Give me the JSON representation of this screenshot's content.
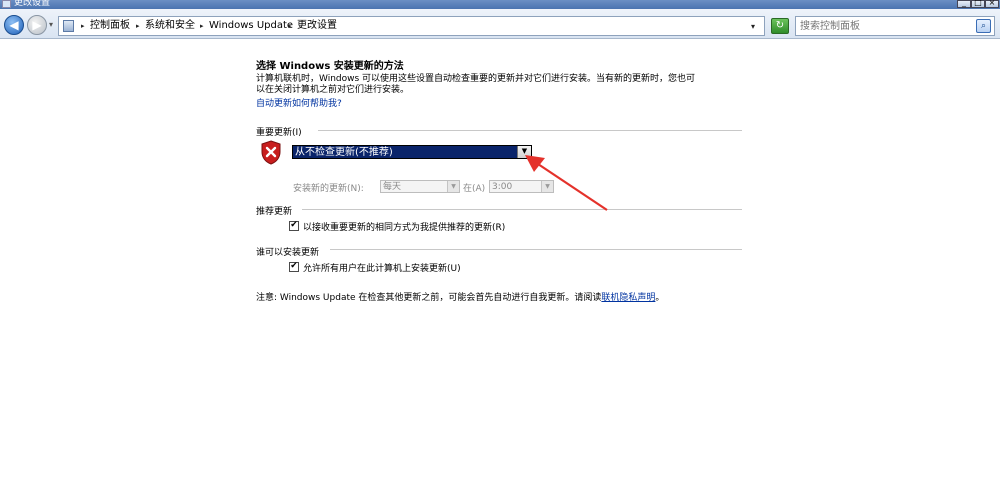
{
  "window": {
    "title": "更改设置"
  },
  "titlebar_buttons": {
    "minimize": "_",
    "maximize": "□",
    "close": "×"
  },
  "nav": {
    "back_glyph": "◀",
    "forward_glyph": "▶",
    "dropdown_glyph": "▾",
    "refresh_glyph": "↻",
    "search_glyph": "⌕"
  },
  "breadcrumb": [
    "控制面板",
    "系统和安全",
    "Windows Update",
    "更改设置"
  ],
  "search": {
    "placeholder": "搜索控制面板"
  },
  "main": {
    "title": "选择 Windows 安装更新的方法",
    "description_line1": "计算机联机时，Windows 可以使用这些设置自动检查重要的更新并对它们进行安装。当有新的更新时，您也可",
    "description_line2": "以在关闭计算机之前对它们进行安装。",
    "help_link": "自动更新如何帮助我?"
  },
  "important_updates": {
    "section_title": "重要更新(I)",
    "selected_option": "从不检查更新(不推荐)",
    "install_label": "安装新的更新(N):",
    "day_value": "每天",
    "at_label": "在(A)",
    "time_value": "3:00"
  },
  "recommended_updates": {
    "section_title": "推荐更新",
    "checkbox_label": "以接收重要更新的相同方式为我提供推荐的更新(R)",
    "checked": true
  },
  "who_can_install": {
    "section_title": "谁可以安装更新",
    "checkbox_label": "允许所有用户在此计算机上安装更新(U)",
    "checked": true
  },
  "note": {
    "text": "注意: Windows Update 在检查其他更新之前，可能会首先自动进行自我更新。请阅读",
    "link": "联机隐私声明",
    "suffix": "。"
  },
  "checkmark_glyph": "✔",
  "colors": {
    "selection_bg": "#0a246a",
    "link": "#0033a0",
    "arrow": "#e4322b",
    "shield": "#c81e1e"
  }
}
